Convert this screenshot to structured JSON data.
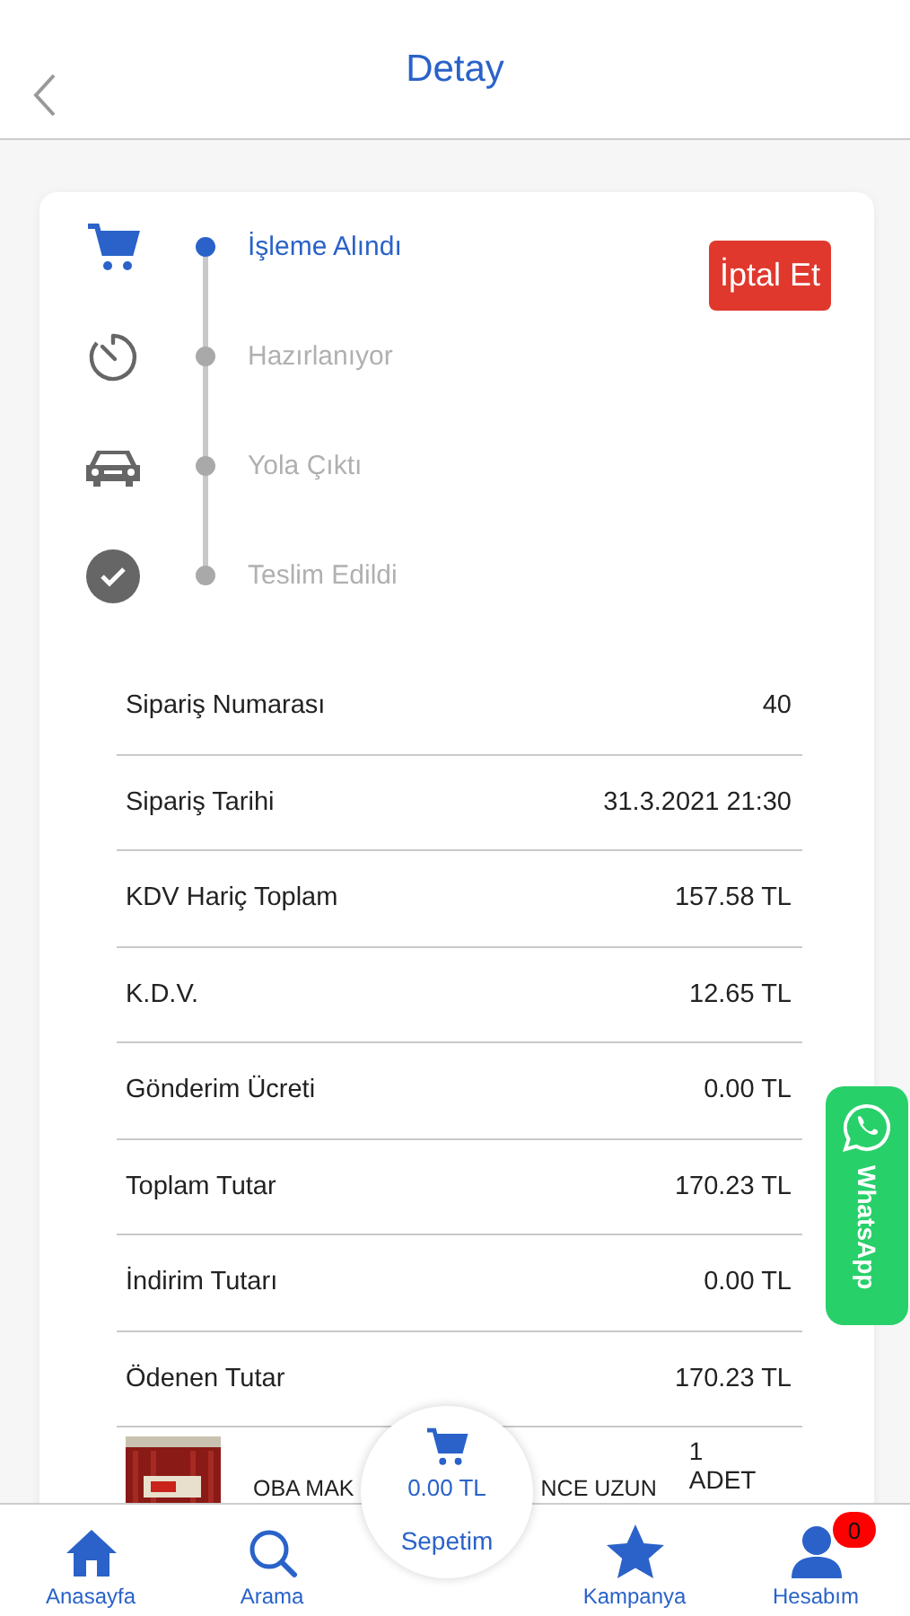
{
  "header": {
    "title": "Detay"
  },
  "steps": [
    {
      "kind": "cart",
      "label": "İşleme Alındı",
      "active": true
    },
    {
      "kind": "timer",
      "label": "Hazırlanıyor",
      "active": false
    },
    {
      "kind": "car",
      "label": "Yola Çıktı",
      "active": false
    },
    {
      "kind": "check",
      "label": "Teslim Edildi",
      "active": false
    }
  ],
  "cancel_button": "İptal Et",
  "details": [
    {
      "label": "Sipariş Numarası",
      "value": "40"
    },
    {
      "label": "Sipariş Tarihi",
      "value": "31.3.2021 21:30"
    },
    {
      "label": "KDV Hariç Toplam",
      "value": "157.58 TL"
    },
    {
      "label": "K.D.V.",
      "value": "12.65 TL"
    },
    {
      "label": "Gönderim Ücreti",
      "value": "0.00 TL"
    },
    {
      "label": "Toplam Tutar",
      "value": "170.23 TL"
    },
    {
      "label": "İndirim Tutarı",
      "value": "0.00 TL"
    },
    {
      "label": "Ödenen Tutar",
      "value": "170.23 TL"
    }
  ],
  "product": {
    "name_fragments": [
      "OBA MAK",
      "NCE UZUN"
    ],
    "quantity": "1",
    "unit": "ADET"
  },
  "whatsapp": "WhatsApp",
  "cart": {
    "total": "0.00 TL",
    "label": "Sepetim"
  },
  "nav": [
    {
      "kind": "home",
      "label": "Anasayfa"
    },
    {
      "kind": "search",
      "label": "Arama"
    },
    {
      "kind": "star",
      "label": "Kampanya"
    },
    {
      "kind": "user",
      "label": "Hesabım",
      "badge": "0"
    }
  ]
}
